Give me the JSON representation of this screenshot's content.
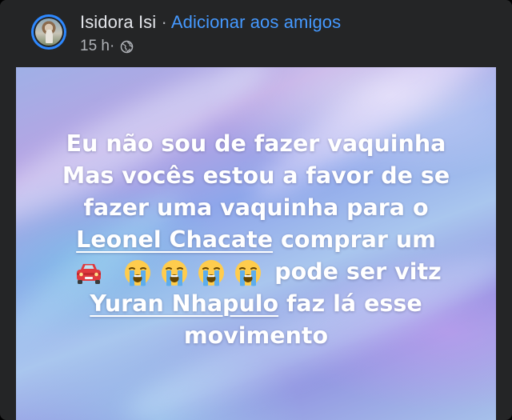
{
  "post": {
    "author_name": "Isidora Isi",
    "separator": " · ",
    "add_friend_label": "Adicionar aos amigos",
    "timestamp": "15 h",
    "meta_separator": " · ",
    "audience_icon": "globe-icon",
    "text_lines": {
      "line1": "Eu não sou de fazer vaquinha",
      "line2": "Mas vocês estou a favor de se",
      "line3": "fazer uma vaquinha para o",
      "line4_mention": "Leonel Chacate",
      "line4_rest": " comprar um",
      "line5_rest": " pode ser vitz",
      "line6_mention": "Yuran Nhapulo",
      "line6_rest": " faz lá esse",
      "line7": "movimento"
    },
    "emojis": [
      "car-emoji",
      "loudly-crying-face-emoji",
      "loudly-crying-face-emoji",
      "loudly-crying-face-emoji",
      "loudly-crying-face-emoji"
    ]
  },
  "colors": {
    "card_background": "#242526",
    "name_text": "#e4e6eb",
    "secondary_text": "#b0b3b8",
    "link_blue": "#4599ff",
    "avatar_ring": "#2d88ff",
    "post_text": "#ffffff"
  }
}
